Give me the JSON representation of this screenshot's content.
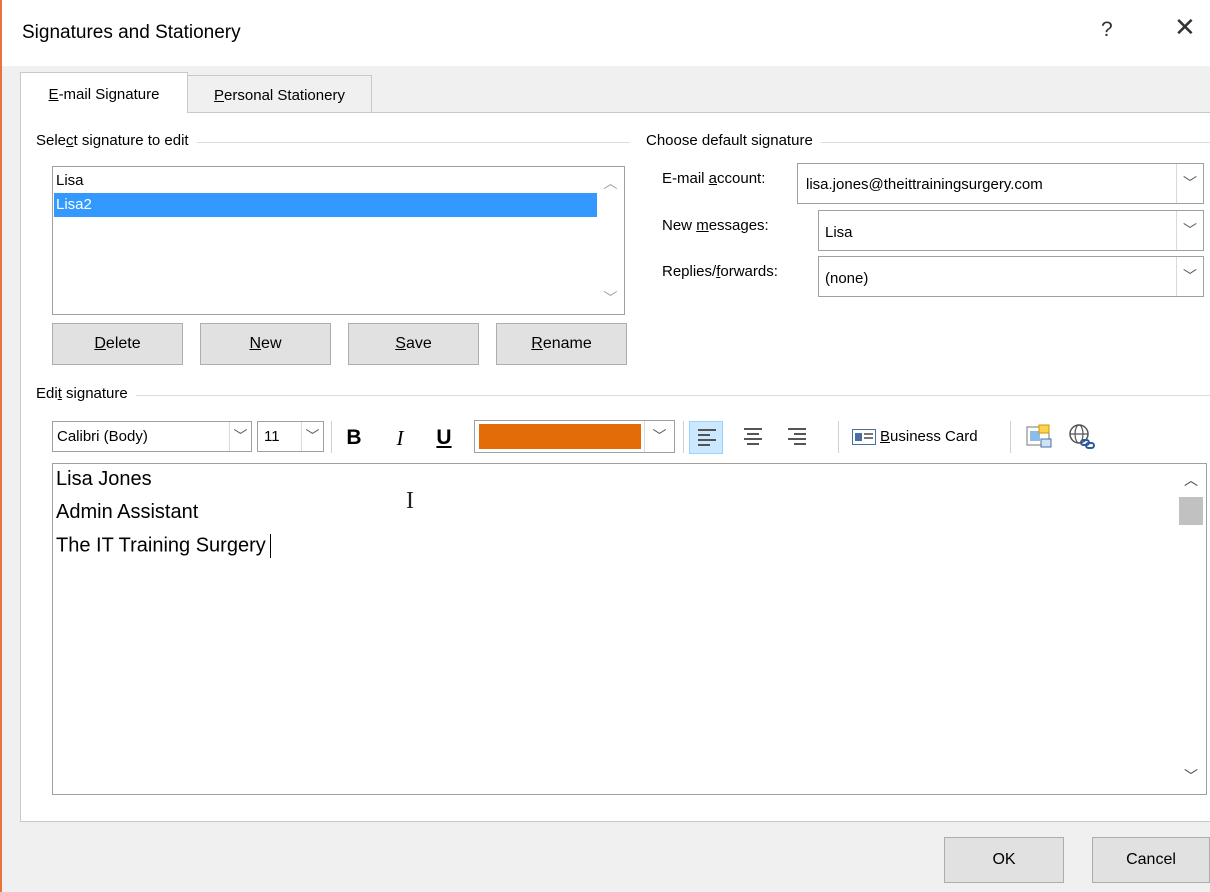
{
  "window": {
    "title": "Signatures and Stationery",
    "help_label": "?",
    "close_label": "✕"
  },
  "tabs": [
    {
      "label_u": "E",
      "label_rest": "-mail Signature",
      "active": true
    },
    {
      "label_u": "P",
      "label_rest": "ersonal Stationery",
      "active": false
    }
  ],
  "select_group": {
    "label_pre": "Sele",
    "label_u": "c",
    "label_post": "t signature to edit",
    "items": [
      "Lisa",
      "Lisa2"
    ],
    "selected_index": 1
  },
  "buttons": {
    "delete": {
      "u": "D",
      "rest": "elete"
    },
    "new": {
      "u": "N",
      "rest": "ew"
    },
    "save": {
      "u": "S",
      "rest": "ave"
    },
    "rename": {
      "u": "R",
      "rest": "ename"
    }
  },
  "default_group": {
    "label": "Choose default signature",
    "email_account": {
      "label_pre": "E-mail ",
      "label_u": "a",
      "label_post": "ccount:",
      "value": "lisa.jones@theittrainingsurgery.com"
    },
    "new_messages": {
      "label_pre": "New ",
      "label_u": "m",
      "label_post": "essages:",
      "value": "Lisa"
    },
    "replies": {
      "label_pre": "Replies/",
      "label_u": "f",
      "label_post": "orwards:",
      "value": "(none)"
    }
  },
  "edit_group": {
    "label_pre": "Edi",
    "label_u": "t",
    "label_post": " signature"
  },
  "toolbar": {
    "font": "Calibri (Body)",
    "size": "11",
    "bold": "B",
    "italic": "I",
    "underline": "U",
    "color": "#e36c09",
    "alignment": "left",
    "business_card_u": "B",
    "business_card_rest": "usiness Card"
  },
  "signature_lines": [
    "Lisa Jones",
    "Admin Assistant",
    "The IT Training Surgery"
  ],
  "footer": {
    "ok": "OK",
    "cancel": "Cancel"
  }
}
